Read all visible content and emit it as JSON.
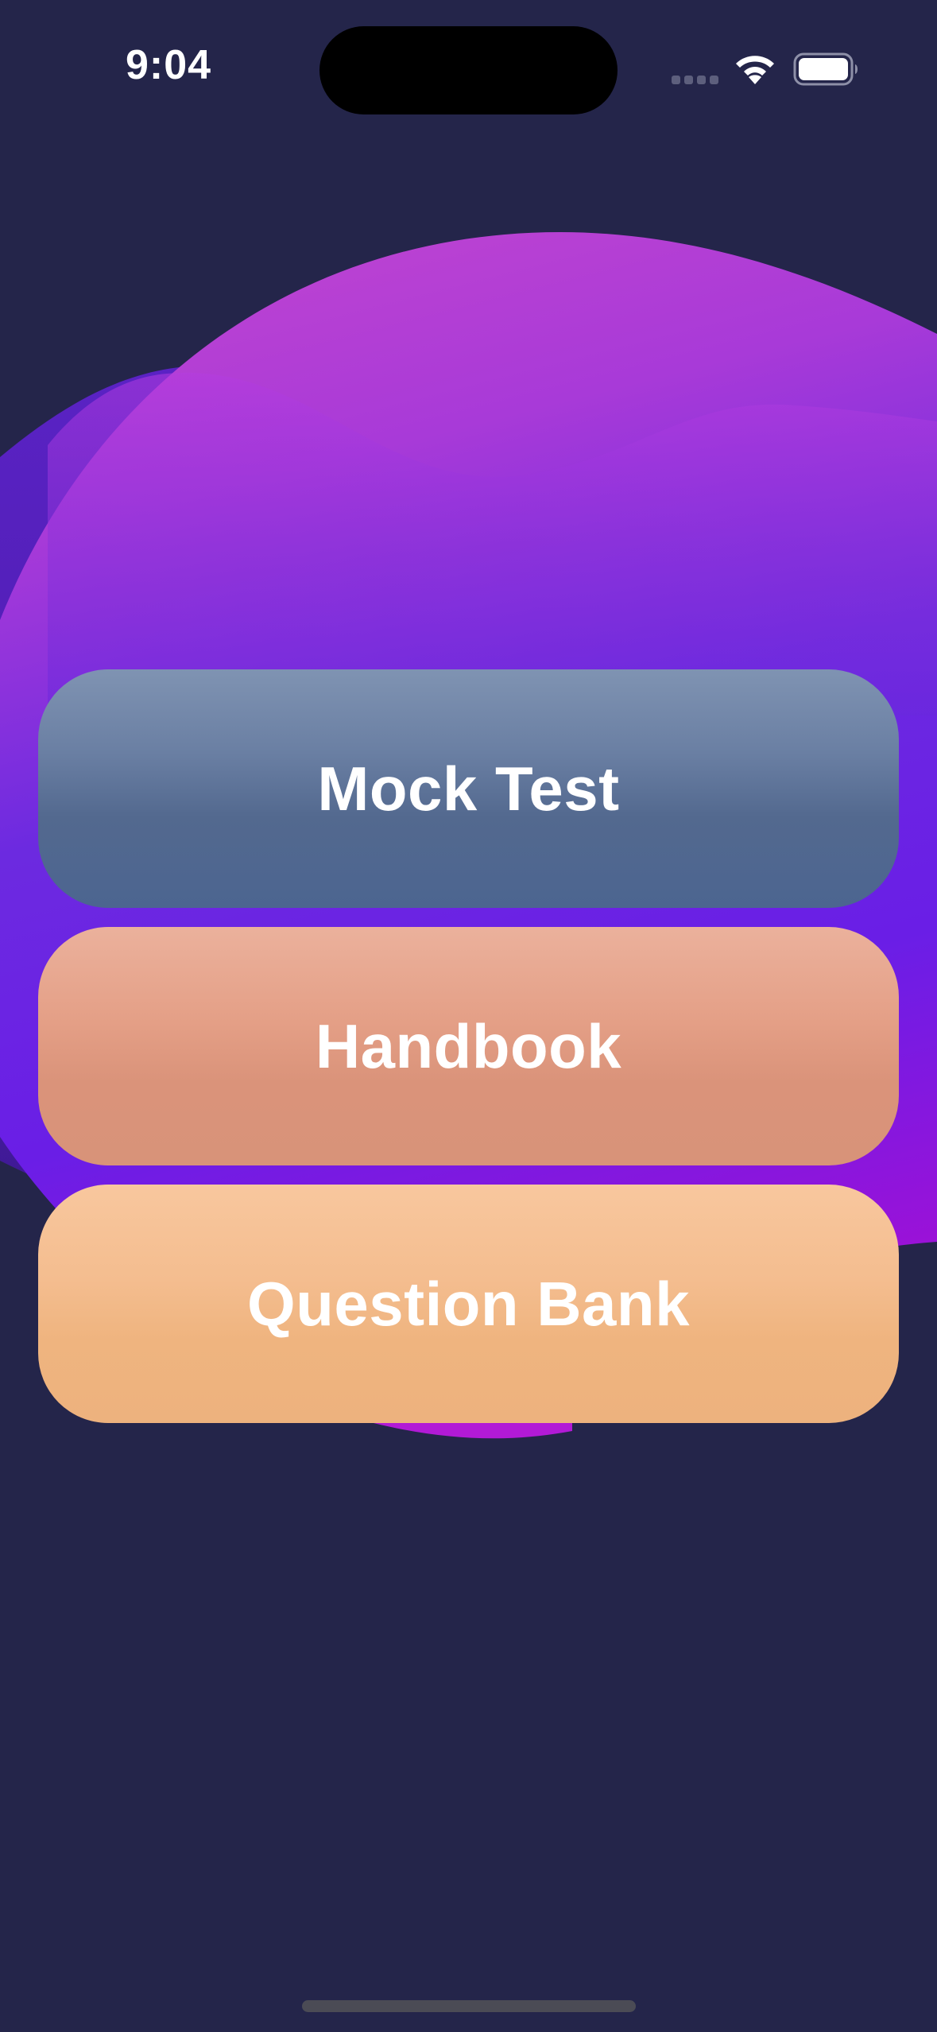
{
  "status_bar": {
    "time": "9:04"
  },
  "menu": {
    "buttons": [
      {
        "label": "Mock Test"
      },
      {
        "label": "Handbook"
      },
      {
        "label": "Question Bank"
      }
    ]
  },
  "colors": {
    "background": "#24254a",
    "mock_test": "#5a7098",
    "handbook": "#e0987f",
    "question_bank": "#f2b987",
    "blob_magenta": "#b33ed6",
    "blob_violet": "#6a22e0"
  },
  "icons": {
    "wifi": "wifi-icon",
    "battery": "battery-icon",
    "signal": "signal-dots-icon"
  }
}
